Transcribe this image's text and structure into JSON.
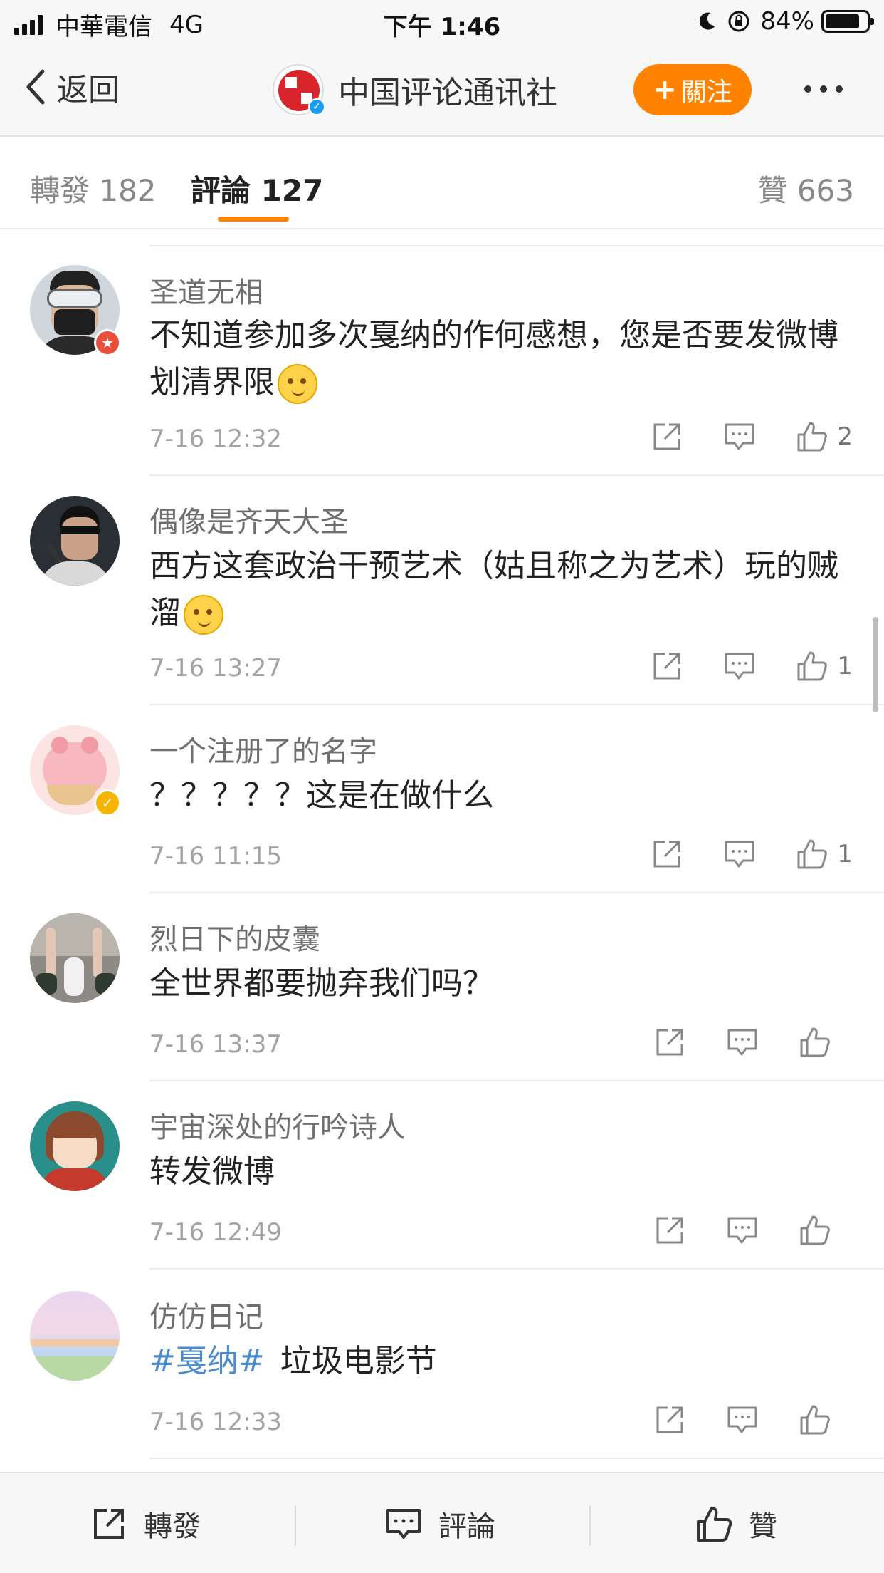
{
  "status_bar": {
    "carrier": "中華電信",
    "network": "4G",
    "time": "下午 1:46",
    "battery_percent": "84%",
    "battery_level": 0.84
  },
  "nav": {
    "back_label": "返回",
    "title": "中国评论通讯社",
    "follow_label": "關注",
    "follow_plus": "+"
  },
  "tabs": {
    "repost": "轉發 182",
    "comment": "評論 127",
    "like": "贊 663"
  },
  "comments": [
    {
      "user": "圣道无相",
      "text": "不知道参加多次戛纳的作何感想，您是否要发微博划清界限",
      "time": "7-16 12:32",
      "likes": "2"
    },
    {
      "user": "偶像是齐天大圣",
      "text": "西方这套政治干预艺术（姑且称之为艺术）玩的贼溜",
      "time": "7-16 13:27",
      "likes": "1"
    },
    {
      "user": "一个注册了的名字",
      "text": "？？？？？这是在做什么",
      "time": "7-16 11:15",
      "likes": "1"
    },
    {
      "user": "烈日下的皮囊",
      "text": "全世界都要抛弃我们吗？",
      "time": "7-16 13:37",
      "likes": ""
    },
    {
      "user": "宇宙深处的行吟诗人",
      "text": "转发微博",
      "time": "7-16 12:49",
      "likes": ""
    },
    {
      "user": "仿仿日记",
      "hashtag": "#戛纳#",
      "text": "垃圾电影节",
      "time": "7-16 12:33",
      "likes": ""
    }
  ],
  "bottom_bar": {
    "repost": "轉發",
    "comment": "評論",
    "like": "贊"
  },
  "colors": {
    "accent": "#ff8200",
    "link": "#4a8bd1",
    "verified": "#1a9df4"
  }
}
